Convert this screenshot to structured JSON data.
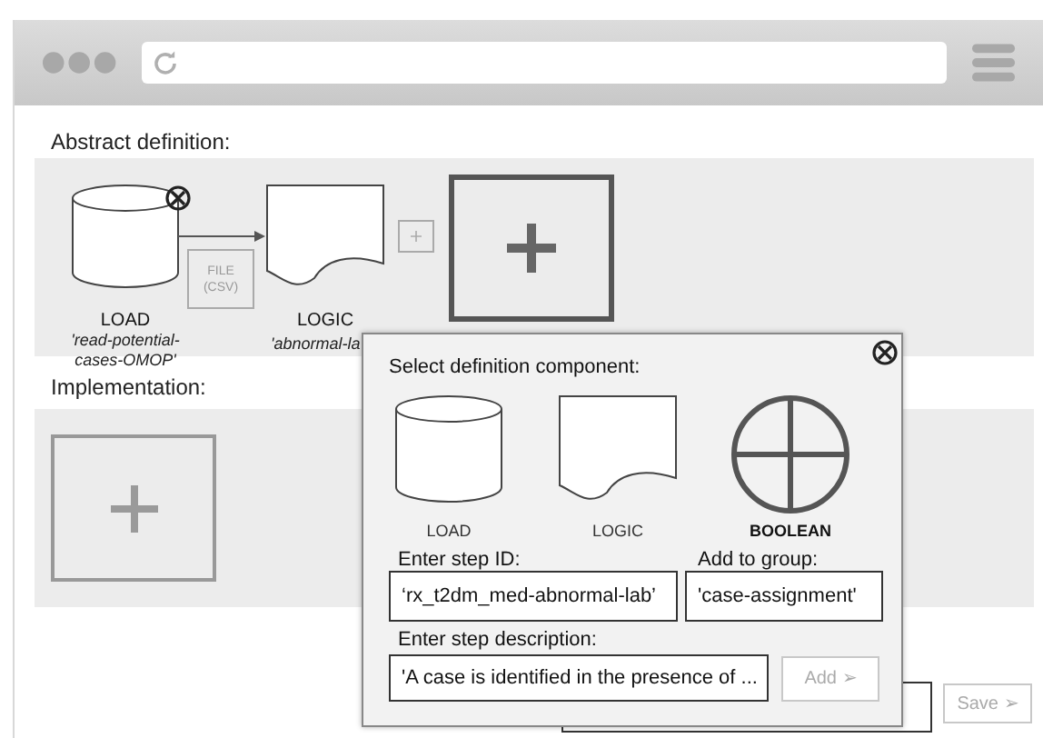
{
  "abstract_definition": {
    "heading": "Abstract definition:",
    "steps": [
      {
        "kind": "load",
        "type_label": "LOAD",
        "name": "'read-potential-cases-OMOP'"
      },
      {
        "kind": "logic",
        "type_label": "LOGIC",
        "name": "'abnormal-la"
      }
    ],
    "connector_label": "FILE (CSV)"
  },
  "implementation": {
    "heading": "Implementation:"
  },
  "dialog": {
    "title": "Select definition component:",
    "components": [
      {
        "kind": "load",
        "label": "LOAD",
        "selected": false
      },
      {
        "kind": "logic",
        "label": "LOGIC",
        "selected": false
      },
      {
        "kind": "boolean",
        "label": "BOOLEAN",
        "selected": true
      }
    ],
    "step_id": {
      "label": "Enter step ID:",
      "value": "‘rx_t2dm_med-abnormal-lab’"
    },
    "group": {
      "label": "Add to group:",
      "value": "'case-assignment'"
    },
    "description": {
      "label": "Enter step description:",
      "value": "'A case is identified in the presence of ..."
    },
    "add_button": {
      "label": "Add ➢",
      "disabled": true
    }
  },
  "save_button": {
    "label": "Save ➢",
    "disabled": true
  }
}
